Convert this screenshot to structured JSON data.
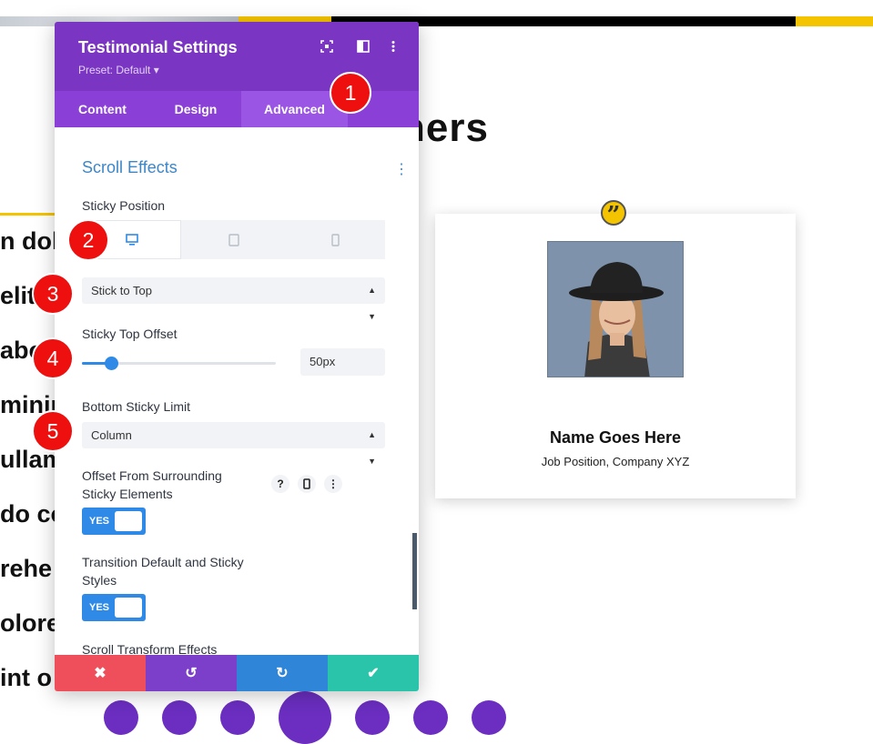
{
  "background": {
    "heading_fragment": "ners",
    "body_line_fragments": [
      "n dol",
      "elit,",
      "abo",
      "minir",
      "ullam",
      "do co",
      "rehe",
      "olore",
      "int o"
    ]
  },
  "testimonial_card": {
    "quote_glyph": "”",
    "name": "Name Goes Here",
    "job": "Job Position, Company XYZ"
  },
  "panel": {
    "title": "Testimonial Settings",
    "preset": "Preset: Default ▾",
    "header_icons": [
      "expand-icon",
      "split-view-icon",
      "more-vertical-icon"
    ],
    "tabs": [
      {
        "label": "Content",
        "active": false
      },
      {
        "label": "Design",
        "active": false
      },
      {
        "label": "Advanced",
        "active": true
      }
    ],
    "section_title": "Scroll Effects",
    "sticky_position": {
      "label": "Sticky Position",
      "devices": [
        "desktop",
        "tablet",
        "phone"
      ],
      "active_device": "desktop",
      "value": "Stick to Top"
    },
    "sticky_top_offset": {
      "label": "Sticky Top Offset",
      "value": "50px",
      "slider_fraction": 0.15
    },
    "bottom_sticky_limit": {
      "label": "Bottom Sticky Limit",
      "value": "Column"
    },
    "offset_surrounding": {
      "label_line1": "Offset From Surrounding",
      "label_line2": "Sticky Elements",
      "toggle": "YES"
    },
    "transition_styles": {
      "label_line1": "Transition Default and Sticky",
      "label_line2": "Styles",
      "toggle": "YES"
    },
    "scroll_transform": {
      "label": "Scroll Transform Effects"
    },
    "footer_buttons": [
      {
        "name": "cancel",
        "icon": "✖",
        "color": "#ef4f5b"
      },
      {
        "name": "undo",
        "icon": "↺",
        "color": "#7c3fc9"
      },
      {
        "name": "redo",
        "icon": "↻",
        "color": "#2f86d8"
      },
      {
        "name": "save",
        "icon": "✔",
        "color": "#29c4a9"
      }
    ]
  },
  "step_badges": [
    "1",
    "2",
    "3",
    "4",
    "5"
  ],
  "colors": {
    "panel_purple": "#7b35c3",
    "tab_purple": "#8a3fd6",
    "accent_blue": "#2e8ae6",
    "badge_red": "#ee0f0f",
    "brand_yellow": "#f5c400"
  }
}
